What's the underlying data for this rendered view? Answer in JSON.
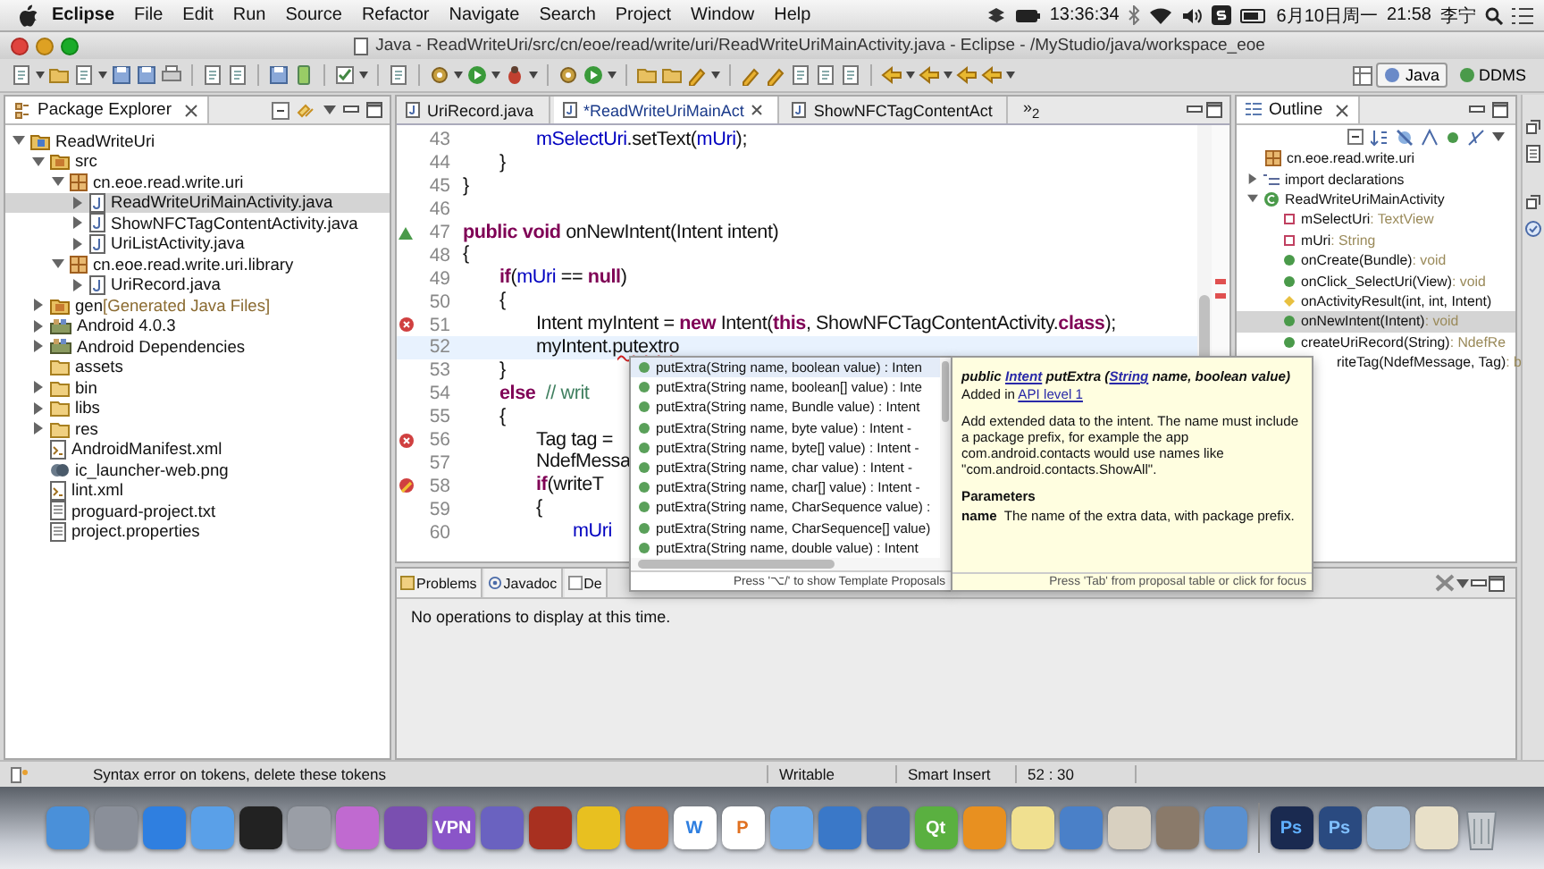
{
  "menu_bar": {
    "app": "Eclipse",
    "items": [
      "File",
      "Edit",
      "Run",
      "Source",
      "Refactor",
      "Navigate",
      "Search",
      "Project",
      "Window",
      "Help"
    ],
    "clock_time": "13:36:34",
    "date": "6月10日周一",
    "time": "21:58",
    "user": "李宁"
  },
  "window": {
    "title": "Java - ReadWriteUri/src/cn/eoe/read/write/uri/ReadWriteUriMainActivity.java - Eclipse - /MyStudio/java/workspace_eoe"
  },
  "perspectives": [
    {
      "label": "Java",
      "selected": true
    },
    {
      "label": "DDMS",
      "selected": false
    }
  ],
  "package_explorer": {
    "title": "Package Explorer",
    "items": [
      {
        "label": "ReadWriteUri",
        "kind": "project",
        "expanded": true,
        "selected": false,
        "children": [
          {
            "label": "src",
            "kind": "source-folder",
            "expanded": true,
            "selected": false,
            "children": [
              {
                "label": "cn.eoe.read.write.uri",
                "kind": "package",
                "expanded": true,
                "selected": false,
                "children": [
                  {
                    "label": "ReadWriteUriMainActivity.java",
                    "kind": "java-file",
                    "expanded": false,
                    "selected": true
                  },
                  {
                    "label": "ShowNFCTagContentActivity.java",
                    "kind": "java-file",
                    "expanded": false,
                    "selected": false
                  },
                  {
                    "label": "UriListActivity.java",
                    "kind": "java-file",
                    "expanded": false,
                    "selected": false
                  }
                ]
              },
              {
                "label": "cn.eoe.read.write.uri.library",
                "kind": "package",
                "expanded": true,
                "selected": false,
                "children": [
                  {
                    "label": "UriRecord.java",
                    "kind": "java-file",
                    "expanded": false,
                    "selected": false
                  }
                ]
              }
            ]
          },
          {
            "label": "gen",
            "suffix": "[Generated Java Files]",
            "kind": "source-folder",
            "expanded": false,
            "selected": false
          },
          {
            "label": "Android 4.0.3",
            "kind": "library",
            "expanded": false,
            "selected": false
          },
          {
            "label": "Android Dependencies",
            "kind": "library",
            "expanded": false,
            "selected": false
          },
          {
            "label": "assets",
            "kind": "folder",
            "selected": false
          },
          {
            "label": "bin",
            "kind": "folder",
            "expanded": false,
            "selected": false
          },
          {
            "label": "libs",
            "kind": "folder",
            "expanded": false,
            "selected": false
          },
          {
            "label": "res",
            "kind": "folder",
            "expanded": false,
            "selected": false
          },
          {
            "label": "AndroidManifest.xml",
            "kind": "xml-file",
            "selected": false
          },
          {
            "label": "ic_launcher-web.png",
            "kind": "image-file",
            "selected": false
          },
          {
            "label": "lint.xml",
            "kind": "xml-file",
            "selected": false
          },
          {
            "label": "proguard-project.txt",
            "kind": "text-file",
            "selected": false
          },
          {
            "label": "project.properties",
            "kind": "text-file",
            "selected": false
          }
        ]
      }
    ]
  },
  "editor": {
    "tabs": [
      {
        "label": "UriRecord.java",
        "selected": false
      },
      {
        "label": "*ReadWriteUriMainAct",
        "selected": true
      },
      {
        "label": "ShowNFCTagContentAct",
        "selected": false
      }
    ],
    "overflow": "»$_{2}$",
    "lines": [
      {
        "number": "43",
        "tokens": [
          {
            "text": "\t\tmSelectUri",
            "kind": "field"
          },
          {
            "text": ".setText(",
            "kind": "plain"
          },
          {
            "text": "mUri",
            "kind": "field"
          },
          {
            "text": ");",
            "kind": "plain"
          }
        ]
      },
      {
        "number": "44",
        "tokens": [
          {
            "text": "\t}",
            "kind": "plain"
          }
        ]
      },
      {
        "number": "45",
        "tokens": [
          {
            "text": "}",
            "kind": "plain"
          }
        ]
      },
      {
        "number": "46"
      },
      {
        "number": "47",
        "kind": "override",
        "tokens": [
          {
            "text": "public",
            "kind": "keyword"
          },
          {
            "text": " void",
            "kind": "keyword"
          },
          {
            "text": " onNewIntent(Intent intent)",
            "kind": "plain"
          }
        ]
      },
      {
        "number": "48",
        "tokens": [
          {
            "text": "{",
            "kind": "plain"
          }
        ]
      },
      {
        "number": "49",
        "tokens": [
          {
            "text": "\tif",
            "kind": "keyword"
          },
          {
            "text": "(",
            "kind": "plain"
          },
          {
            "text": "mUri",
            "kind": "field"
          },
          {
            "text": " == ",
            "kind": "plain"
          },
          {
            "text": "null",
            "kind": "keyword"
          },
          {
            "text": ")",
            "kind": "plain"
          }
        ]
      },
      {
        "number": "50",
        "tokens": [
          {
            "text": "\t{",
            "kind": "plain"
          }
        ]
      },
      {
        "number": "51",
        "kind": "error",
        "tokens": [
          {
            "text": "\t\tIntent myIntent = ",
            "kind": "plain"
          },
          {
            "text": "new",
            "kind": "keyword"
          },
          {
            "text": " Intent(",
            "kind": "plain"
          },
          {
            "text": "this",
            "kind": "keyword"
          },
          {
            "text": ", ShowNFCTagContentActivity.",
            "kind": "plain"
          },
          {
            "text": "class",
            "kind": "keyword"
          },
          {
            "text": ");",
            "kind": "plain"
          }
        ]
      },
      {
        "number": "52",
        "current": true,
        "tokens": [
          {
            "text": "\t\tmyIntent.",
            "kind": "plain"
          },
          {
            "text": "putextro",
            "kind": "error"
          }
        ]
      },
      {
        "number": "53",
        "tokens": [
          {
            "text": "\t}",
            "kind": "plain"
          }
        ]
      },
      {
        "number": "54",
        "tokens": [
          {
            "text": "\telse",
            "kind": "keyword"
          },
          {
            "text": "  // writ",
            "kind": "comment"
          }
        ]
      },
      {
        "number": "55",
        "tokens": [
          {
            "text": "\t{",
            "kind": "plain"
          }
        ]
      },
      {
        "number": "56",
        "kind": "error",
        "tokens": [
          {
            "text": "\t\tTag tag =",
            "kind": "plain"
          }
        ]
      },
      {
        "number": "57",
        "tokens": [
          {
            "text": "\t\tNdefMessa",
            "kind": "plain"
          }
        ]
      },
      {
        "number": "58",
        "kind": "quickfix",
        "tokens": [
          {
            "text": "\t\tif",
            "kind": "keyword"
          },
          {
            "text": "(writeT",
            "kind": "plain"
          }
        ]
      },
      {
        "number": "59",
        "tokens": [
          {
            "text": "\t\t{",
            "kind": "plain"
          }
        ]
      },
      {
        "number": "60",
        "tokens": [
          {
            "text": "\t\t\tmUri",
            "kind": "field"
          }
        ]
      }
    ]
  },
  "completion": {
    "items": [
      {
        "label": "putExtra(String name, boolean value) : Inten",
        "selected": true
      },
      {
        "label": "putExtra(String name, boolean[] value) : Inte",
        "selected": false
      },
      {
        "label": "putExtra(String name, Bundle value) : Intent",
        "selected": false
      },
      {
        "label": "putExtra(String name, byte value) : Intent -",
        "selected": false
      },
      {
        "label": "putExtra(String name, byte[] value) : Intent -",
        "selected": false
      },
      {
        "label": "putExtra(String name, char value) : Intent -",
        "selected": false
      },
      {
        "label": "putExtra(String name, char[] value) : Intent -",
        "selected": false
      },
      {
        "label": "putExtra(String name, CharSequence value) :",
        "selected": false
      },
      {
        "label": "putExtra(String name, CharSequence[] value)",
        "selected": false
      },
      {
        "label": "putExtra(String name, double value) : Intent",
        "selected": false
      }
    ],
    "footer": "Press '⌥/' to show Template Proposals"
  },
  "javadoc_hover": {
    "signature": [
      {
        "text": "public ",
        "kind": "text"
      },
      {
        "text": "Intent",
        "kind": "link"
      },
      {
        "text": " putExtra (",
        "kind": "text"
      },
      {
        "text": "String",
        "kind": "link"
      },
      {
        "text": " name, boolean value)",
        "kind": "text"
      }
    ],
    "added": [
      {
        "text": "Added in ",
        "kind": "text"
      },
      {
        "text": "API level 1",
        "kind": "link"
      }
    ],
    "description": "Add extended data to the intent. The name must include a package prefix, for example the app com.android.contacts would use names like \"com.android.contacts.ShowAll\".",
    "parameters_heading": "Parameters",
    "parameters": [
      {
        "name": "name",
        "description": "The name of the extra data, with package prefix."
      }
    ],
    "footer": "Press 'Tab' from proposal table or click for focus"
  },
  "outline": {
    "title": "Outline",
    "items": [
      {
        "label": "cn.eoe.read.write.uri",
        "kind": "package",
        "selected": false
      },
      {
        "label": "import declarations",
        "kind": "imports",
        "expanded": false,
        "selected": false
      },
      {
        "label": "ReadWriteUriMainActivity",
        "kind": "class",
        "expanded": true,
        "selected": false,
        "children": [
          {
            "label": "mSelectUri",
            "type": ": TextView",
            "kind": "field",
            "selected": false
          },
          {
            "label": "mUri",
            "type": ": String",
            "kind": "field",
            "selected": false
          },
          {
            "label": "onCreate(Bundle)",
            "type": ": void",
            "kind": "method",
            "selected": false
          },
          {
            "label": "onClick_SelectUri(View)",
            "type": ": void",
            "kind": "method",
            "selected": false
          },
          {
            "label": "onActivityResult(int, int, Intent)",
            "kind": "protected-method",
            "selected": false
          },
          {
            "label": "onNewIntent(Intent)",
            "type": ": void",
            "kind": "method",
            "selected": true
          },
          {
            "label": "createUriRecord(String)",
            "type": ": NdefRe",
            "kind": "method",
            "selected": false
          },
          {
            "label": "riteTag(NdefMessage, Tag)",
            "type": ": b",
            "kind": "covered",
            "selected": false
          }
        ]
      }
    ]
  },
  "bottom_panel": {
    "tabs": [
      {
        "label": "Problems",
        "kind": "problems",
        "selected": false
      },
      {
        "label": "Javadoc",
        "kind": "javadoc",
        "selected": false
      },
      {
        "label": "De",
        "kind": "declaration",
        "selected": false
      }
    ],
    "message": "No operations to display at this time."
  },
  "status_bar": {
    "message": "Syntax error on tokens, delete these tokens",
    "mode": "Writable",
    "insert_mode": "Smart Insert",
    "position": "52 : 30"
  },
  "dock_labels": [
    "VPN",
    "W",
    "P",
    "Qt",
    "Ps",
    "Ps"
  ]
}
